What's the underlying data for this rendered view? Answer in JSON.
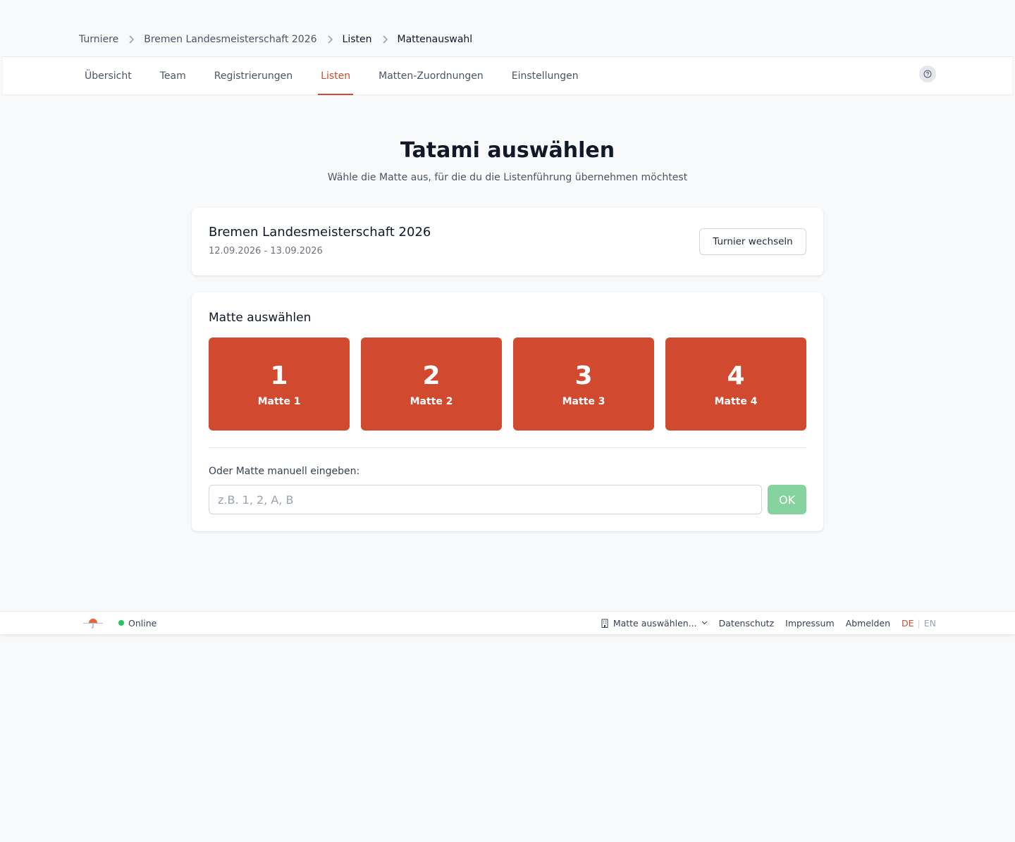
{
  "breadcrumb": {
    "items": [
      "Turniere",
      "Bremen Landesmeisterschaft 2026",
      "Listen",
      "Mattenauswahl"
    ]
  },
  "nav": {
    "tabs": [
      {
        "label": "Übersicht",
        "active": false
      },
      {
        "label": "Team",
        "active": false
      },
      {
        "label": "Registrierungen",
        "active": false
      },
      {
        "label": "Listen",
        "active": true
      },
      {
        "label": "Matten-Zuordnungen",
        "active": false
      },
      {
        "label": "Einstellungen",
        "active": false
      }
    ],
    "help_icon": "question-circle-icon"
  },
  "page": {
    "title": "Tatami auswählen",
    "subtitle": "Wähle die Matte aus, für die du die Listenführung übernehmen möchtest"
  },
  "tournament": {
    "name": "Bremen Landesmeisterschaft 2026",
    "dates": "12.09.2026 - 13.09.2026",
    "switch_label": "Turnier wechseln"
  },
  "mat_selection": {
    "title": "Matte auswählen",
    "mats": [
      {
        "number": "1",
        "label": "Matte 1"
      },
      {
        "number": "2",
        "label": "Matte 2"
      },
      {
        "number": "3",
        "label": "Matte 3"
      },
      {
        "number": "4",
        "label": "Matte 4"
      }
    ],
    "manual_label": "Oder Matte manuell eingeben:",
    "manual_placeholder": "z.B. 1, 2, A, B",
    "manual_value": "",
    "ok_label": "OK"
  },
  "footer": {
    "status": "Online",
    "mat_select": "Matte auswählen...",
    "links": [
      "Datenschutz",
      "Impressum",
      "Abmelden"
    ],
    "lang_de": "DE",
    "lang_en": "EN"
  },
  "colors": {
    "accent": "#d1492e",
    "ok_button": "#86d3a0",
    "online": "#22c55e"
  }
}
